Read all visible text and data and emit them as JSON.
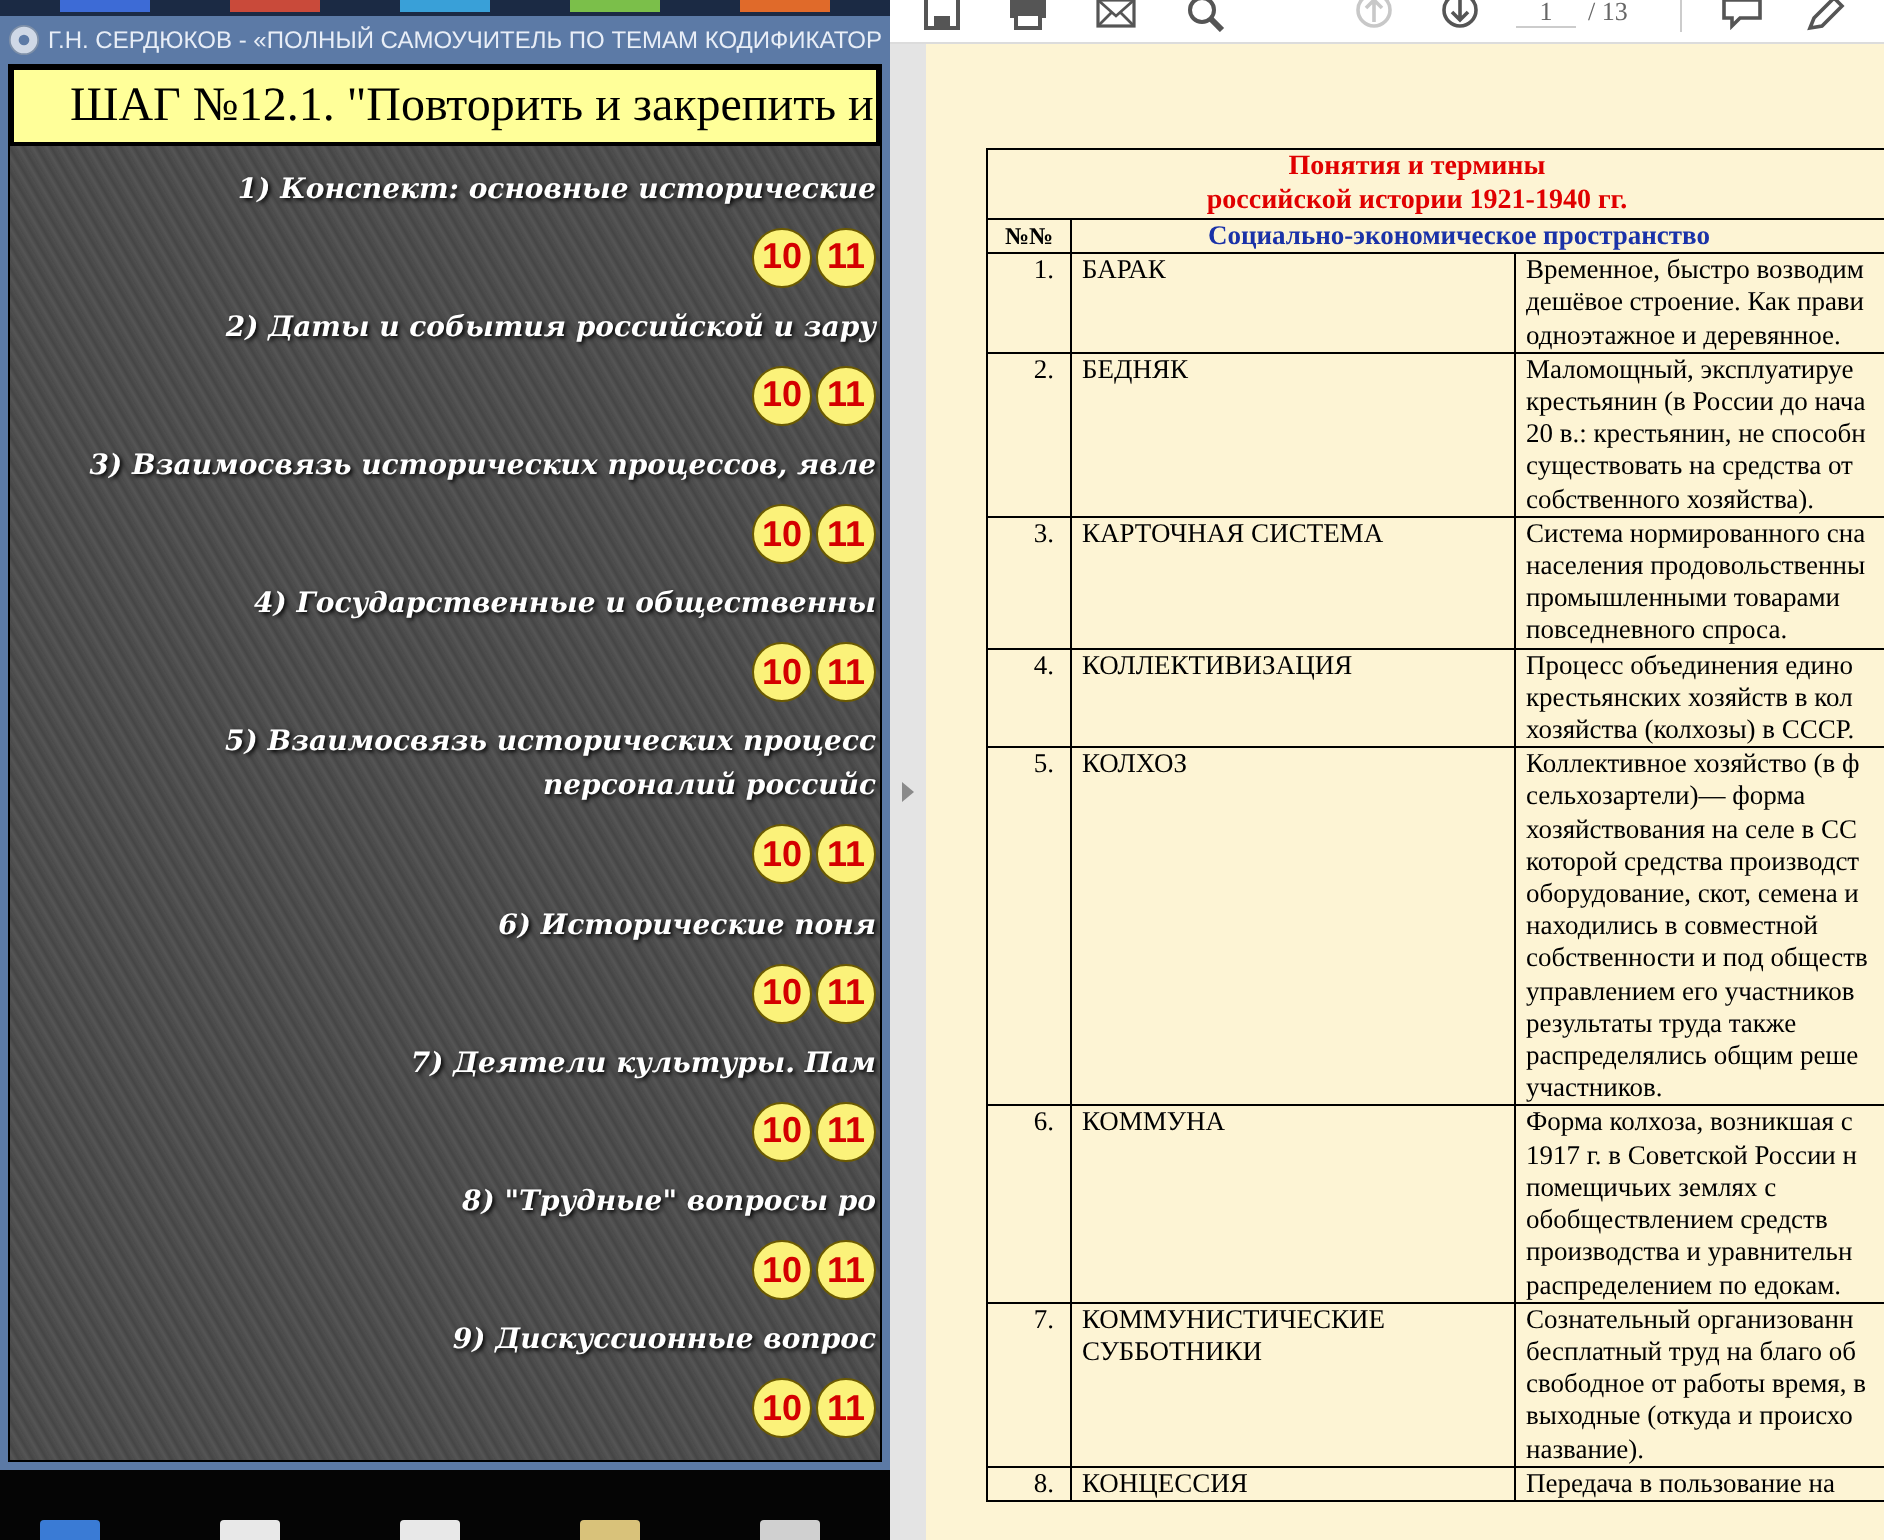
{
  "left_window": {
    "title": "Г.Н. СЕРДЮКОВ - «ПОЛНЫЙ САМОУЧИТЕЛЬ ПО ТЕМАМ КОДИФИКАТОР",
    "heading": "ШАГ №12.1. \"Повторить и закрепить и",
    "items": [
      {
        "lines": [
          "1) Конспект: основные исторические"
        ],
        "badges": [
          "10",
          "11"
        ]
      },
      {
        "lines": [
          "2) Даты и события российской и зару"
        ],
        "badges": [
          "10",
          "11"
        ]
      },
      {
        "lines": [
          "3) Взаимосвязь исторических процессов, явле"
        ],
        "badges": [
          "10",
          "11"
        ]
      },
      {
        "lines": [
          "4) Государственные и общественны"
        ],
        "badges": [
          "10",
          "11"
        ]
      },
      {
        "lines": [
          "5) Взаимосвязь исторических процесс",
          "персоналий российс"
        ],
        "badges": [
          "10",
          "11"
        ]
      },
      {
        "lines": [
          "6) Исторические поня"
        ],
        "badges": [
          "10",
          "11"
        ]
      },
      {
        "lines": [
          "7) Деятели культуры. Пам"
        ],
        "badges": [
          "10",
          "11"
        ]
      },
      {
        "lines": [
          "8) \"Трудные\" вопросы ро"
        ],
        "badges": [
          "10",
          "11"
        ]
      },
      {
        "lines": [
          "9) Дискуссионные вопрос"
        ],
        "badges": [
          "10",
          "11"
        ]
      }
    ]
  },
  "pdf_viewer": {
    "toolbar": {
      "tools": [
        {
          "kind": "save",
          "disabled": false
        },
        {
          "kind": "print",
          "disabled": false
        },
        {
          "kind": "mail",
          "disabled": false
        },
        {
          "kind": "zoom",
          "disabled": false
        },
        {
          "kind": "prev",
          "disabled": true
        },
        {
          "kind": "next",
          "disabled": false
        }
      ],
      "page_current": "1",
      "page_total": "/ 13",
      "extra_tools": [
        {
          "kind": "comment"
        },
        {
          "kind": "pen"
        }
      ]
    },
    "table": {
      "title_lines": [
        "Понятия и термины",
        "российской истории 1921-1940 гг."
      ],
      "column_1": "№№",
      "section": "Социально-экономическое пространство",
      "rows": [
        {
          "number": "1.",
          "term": "БАРАК",
          "definition_lines": [
            "Временное, быстро возводим",
            "дешёвое строение. Как прави",
            "одноэтажное и деревянное."
          ]
        },
        {
          "number": "2.",
          "term": "БЕДНЯК",
          "definition_lines": [
            "Маломощный, эксплуатируе",
            "крестьянин (в России до нача",
            "20 в.: крестьянин, не способн",
            "существовать на средства от",
            "собственного хозяйства)."
          ]
        },
        {
          "number": "3.",
          "term": "КАРТОЧНАЯ СИСТЕМА",
          "definition_lines": [
            "Система нормированного сна",
            "населения продовольственны",
            "промышленными товарами",
            "повседневного спроса."
          ]
        },
        {
          "number": "4.",
          "term": "КОЛЛЕКТИВИЗАЦИЯ",
          "definition_lines": [
            "Процесс объединения едино",
            "крестьянских хозяйств в кол",
            "хозяйства (колхозы) в СССР."
          ]
        },
        {
          "number": "5.",
          "term": "КОЛХОЗ",
          "definition_lines": [
            "Коллективное хозяйство (в ф",
            "сельхозартели)— форма",
            "хозяйствования на селе в СС",
            "которой средства производст",
            "оборудование, скот, семена и",
            "находились в совместной",
            "собственности и под обществ",
            "управлением его участников",
            "результаты труда также",
            "распределялись общим реше",
            "участников."
          ]
        },
        {
          "number": "6.",
          "term": "КОММУНА",
          "definition_lines": [
            "Форма колхоза, возникшая с",
            "1917 г. в Советской России н",
            "помещичьих землях с",
            "обобществлением средств",
            "производства и уравнительн",
            "распределением по едокам."
          ]
        },
        {
          "number": "7.",
          "term": "КОММУНИСТИЧЕСКИЕ СУББОТНИКИ",
          "definition_lines": [
            "Сознательный организованн",
            "бесплатный труд на благо об",
            "свободное от работы время, в",
            "выходные (откуда и происхо",
            "название)."
          ]
        },
        {
          "number": "8.",
          "term": "КОНЦЕССИЯ",
          "definition_lines": [
            "Передача в пользование на"
          ]
        }
      ]
    }
  }
}
